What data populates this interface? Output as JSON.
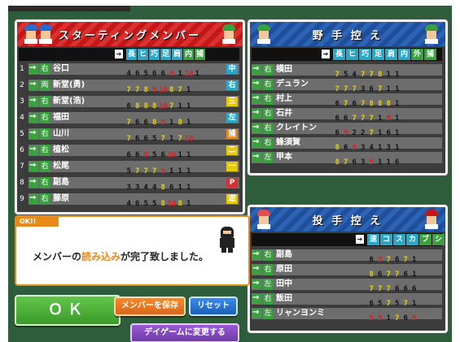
{
  "starting": {
    "title": "スターティングメンバー",
    "positions": [
      "長",
      "ヒ",
      "巧",
      "足",
      "肩",
      "内",
      "捕"
    ],
    "rows": [
      {
        "num": "1",
        "hand": "右",
        "name": "谷口",
        "stats": [
          "4",
          "6",
          "5",
          "6",
          "6",
          "9",
          "1",
          "10",
          "1"
        ],
        "pos": "中",
        "pos_color": "#2aa6c8"
      },
      {
        "num": "2",
        "hand": "両",
        "name": "新堂(勇)",
        "stats": [
          "7",
          "7",
          "8",
          "9",
          "10",
          "8",
          "7",
          "1"
        ],
        "pos": "右",
        "pos_color": "#2aa6c8"
      },
      {
        "num": "3",
        "hand": "右",
        "name": "新堂(浩)",
        "stats": [
          "6",
          "8",
          "8",
          "8",
          "10",
          "7",
          "1",
          "1"
        ],
        "pos": "三",
        "pos_color": "#e8c80a"
      },
      {
        "num": "4",
        "hand": "右",
        "name": "福田",
        "stats": [
          "7",
          "6",
          "6",
          "8",
          "9",
          "1",
          "8",
          "1"
        ],
        "pos": "左",
        "pos_color": "#2aa6c8"
      },
      {
        "num": "5",
        "hand": "右",
        "name": "山川",
        "stats": [
          "7",
          "6",
          "6",
          "5",
          "7",
          "1",
          "7",
          "10"
        ],
        "pos": "捕",
        "pos_color": "#e88a1a"
      },
      {
        "num": "6",
        "hand": "右",
        "name": "植松",
        "stats": [
          "6",
          "6",
          "9",
          "5",
          "6",
          "10",
          "1",
          "1"
        ],
        "pos": "二",
        "pos_color": "#e8c80a"
      },
      {
        "num": "7",
        "hand": "右",
        "name": "松尾",
        "stats": [
          "5",
          "7",
          "7",
          "7",
          "9",
          "1",
          "1",
          "1"
        ],
        "pos": "一",
        "pos_color": "#e8c80a"
      },
      {
        "num": "8",
        "hand": "右",
        "name": "副島",
        "stats": [
          "3",
          "3",
          "4",
          "4",
          "8",
          "6",
          "1",
          "1"
        ],
        "pos": "P",
        "pos_color": "#d83030"
      },
      {
        "num": "9",
        "hand": "右",
        "name": "藤原",
        "stats": [
          "4",
          "6",
          "5",
          "5",
          "8",
          "10",
          "8",
          "1"
        ],
        "pos": "遊",
        "pos_color": "#e8c80a"
      }
    ]
  },
  "fielders": {
    "title": "野 手 控 え",
    "positions": [
      "長",
      "ヒ",
      "巧",
      "足",
      "肩",
      "内",
      "外",
      "捕"
    ],
    "rows": [
      {
        "hand": "右",
        "name": "横田",
        "stats": [
          "7",
          "5",
          "4",
          "7",
          "7",
          "8",
          "1",
          "1"
        ]
      },
      {
        "hand": "右",
        "name": "デュラン",
        "stats": [
          "7",
          "7",
          "7",
          "3",
          "6",
          "7",
          "1",
          "1"
        ]
      },
      {
        "hand": "右",
        "name": "村上",
        "stats": [
          "6",
          "7",
          "6",
          "7",
          "8",
          "8",
          "8",
          "1"
        ]
      },
      {
        "hand": "右",
        "name": "石井",
        "stats": [
          "6",
          "6",
          "7",
          "7",
          "7",
          "1",
          "9",
          "1"
        ]
      },
      {
        "hand": "右",
        "name": "クレイトン",
        "stats": [
          "6",
          "9",
          "2",
          "2",
          "7",
          "1",
          "6",
          "1"
        ]
      },
      {
        "hand": "右",
        "name": "蜂須賀",
        "stats": [
          "8",
          "6",
          "9",
          "3",
          "4",
          "1",
          "3",
          "1"
        ]
      },
      {
        "hand": "左",
        "name": "甲本",
        "stats": [
          "8",
          "7",
          "6",
          "3",
          "9",
          "1",
          "1",
          "6"
        ]
      }
    ]
  },
  "pitchers": {
    "title": "投 手 控 え",
    "positions": [
      "速",
      "コ",
      "ス",
      "カ",
      "ブ",
      "シ"
    ],
    "rows": [
      {
        "hand": "右",
        "name": "副島",
        "stats": [
          "6",
          "9",
          "7",
          "6",
          "7",
          "1"
        ]
      },
      {
        "hand": "右",
        "name": "原田",
        "stats": [
          "8",
          "6",
          "7",
          "7",
          "6",
          "1"
        ]
      },
      {
        "hand": "左",
        "name": "田中",
        "stats": [
          "7",
          "7",
          "7",
          "6",
          "6",
          "6"
        ]
      },
      {
        "hand": "右",
        "name": "飯田",
        "stats": [
          "6",
          "5",
          "7",
          "5",
          "7",
          "1"
        ]
      },
      {
        "hand": "左",
        "name": "リャンヨンミ",
        "stats": [
          "9",
          "9",
          "1",
          "7",
          "6",
          "9"
        ]
      }
    ]
  },
  "message": {
    "badge": "OK!!",
    "pre": "メンバーの",
    "highlight": "読み込み",
    "post": "が完了致しました。"
  },
  "buttons": {
    "ok": "ＯＫ",
    "save": "メンバーを保存",
    "reset": "リセット",
    "day": "デイゲームに変更する"
  },
  "colors": {
    "accent_red": "#c41818",
    "accent_blue": "#1f4f98",
    "ok_green": "#3b9a2a",
    "orange": "#e88a1a",
    "purple": "#6f3aa8"
  }
}
